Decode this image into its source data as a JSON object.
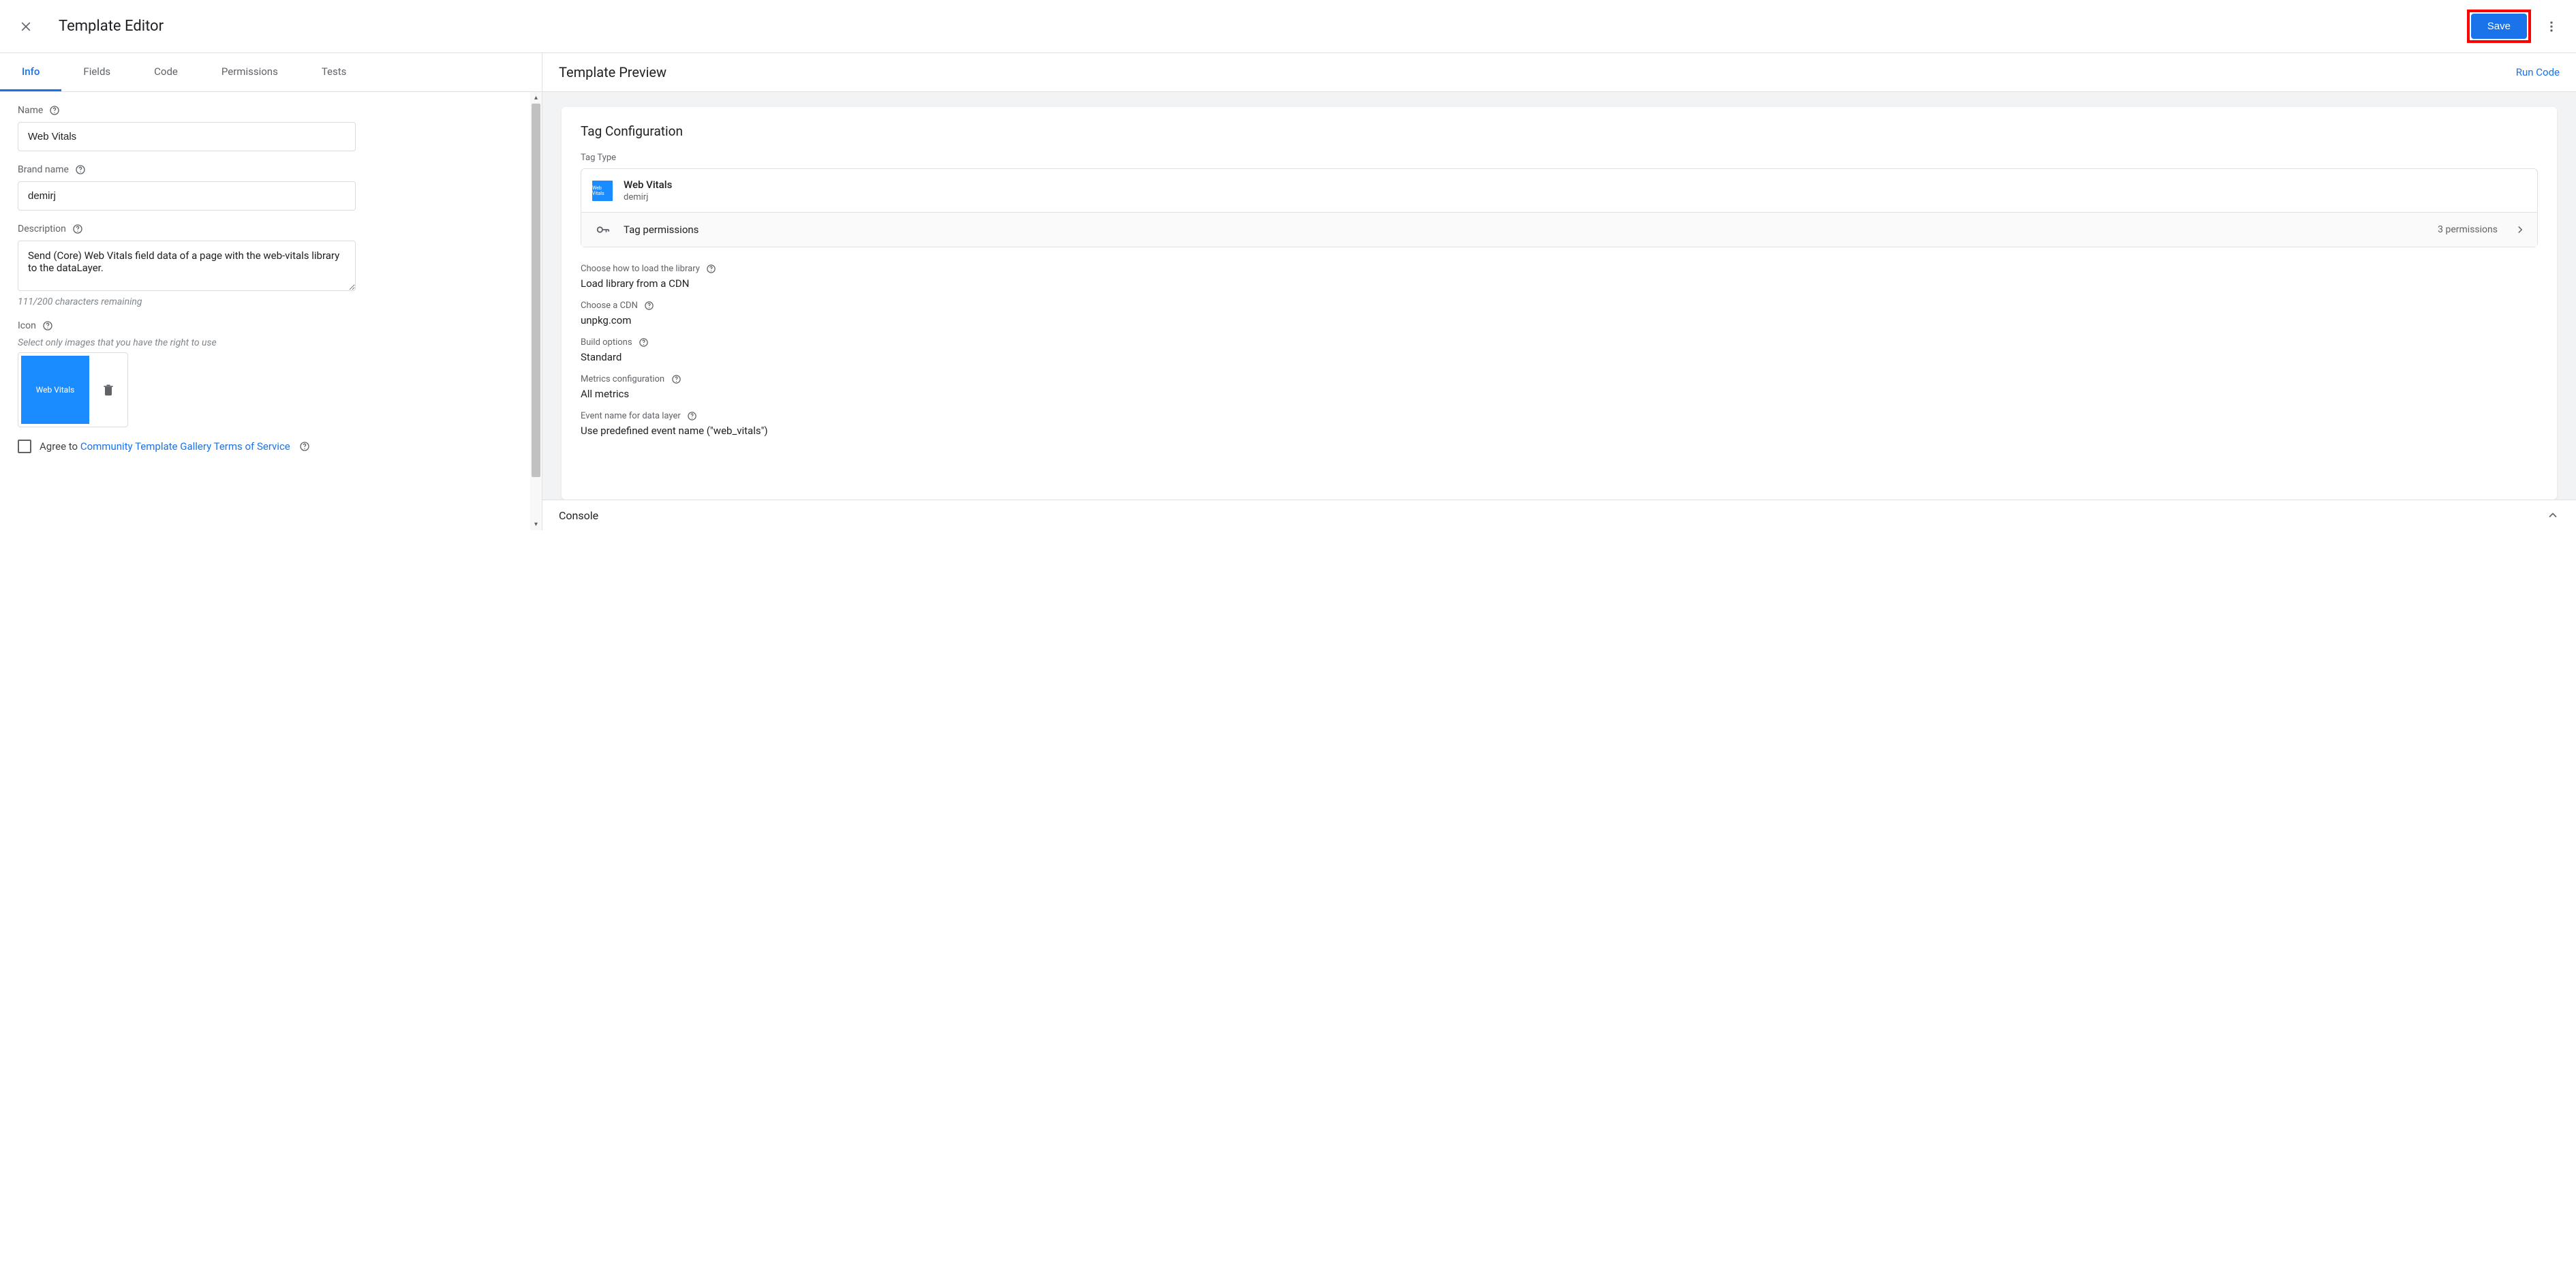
{
  "toolbar": {
    "title": "Template Editor",
    "save_label": "Save"
  },
  "tabs": [
    "Info",
    "Fields",
    "Code",
    "Permissions",
    "Tests"
  ],
  "activeTab": 0,
  "form": {
    "name_label": "Name",
    "name_value": "Web Vitals",
    "brand_label": "Brand name",
    "brand_value": "demirj",
    "desc_label": "Description",
    "desc_value": "Send (Core) Web Vitals field data of a page with the web-vitals library to the dataLayer.",
    "desc_remaining": "111/200 characters remaining",
    "icon_label": "Icon",
    "icon_hint": "Select only images that you have the right to use",
    "icon_thumb_text": "Web Vitals",
    "agree_prefix": "Agree to ",
    "agree_link": "Community Template Gallery Terms of Service"
  },
  "preview": {
    "title": "Template Preview",
    "run_code": "Run Code",
    "tag_config_title": "Tag Configuration",
    "tag_type_label": "Tag Type",
    "tag_name": "Web Vitals",
    "tag_brand": "demirj",
    "permissions_label": "Tag permissions",
    "permissions_count": "3 permissions",
    "cfg": [
      {
        "label": "Choose how to load the library",
        "value": "Load library from a CDN",
        "help": true
      },
      {
        "label": "Choose a CDN",
        "value": "unpkg.com",
        "help": true
      },
      {
        "label": "Build options",
        "value": "Standard",
        "help": true
      },
      {
        "label": "Metrics configuration",
        "value": "All metrics",
        "help": true
      },
      {
        "label": "Event name for data layer",
        "value": "Use predefined event name (\"web_vitals\")",
        "help": true
      }
    ]
  },
  "console": {
    "title": "Console"
  }
}
